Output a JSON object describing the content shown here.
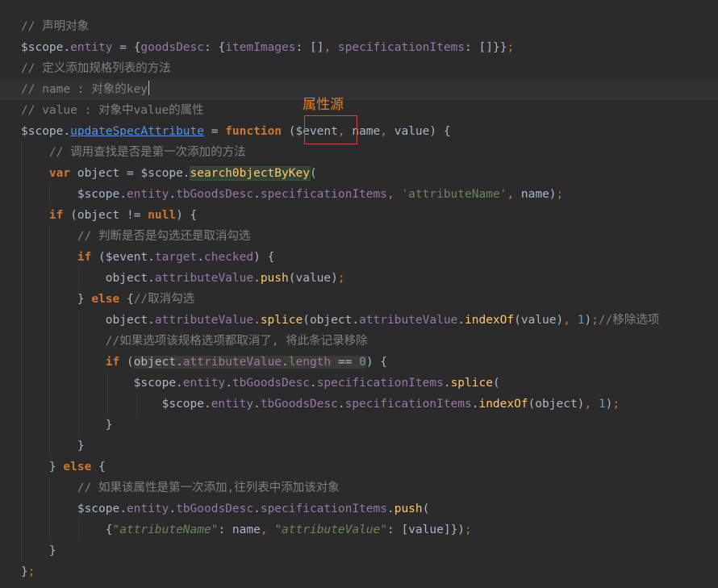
{
  "annotation": {
    "label": "属性源",
    "box_color": "#d8423a",
    "label_color": "#e87f1f"
  },
  "code": {
    "l1_comment": "// 声明对象",
    "l3_comment": "// 定义添加规格列表的方法",
    "l4_comment": "// name : 对象的key",
    "l5_comment": "// value : 对象中value的属性",
    "fn_name": "updateSpecAttribute",
    "call_search": "search0bjectByKey",
    "l7_comment": "// 调用查找是否是第一次添加的方法",
    "l11_comment": "// 判断是否是勾选还是取消勾选",
    "l14_comment": "//取消勾选",
    "l15_comment": "//移除选项",
    "l16_comment": "//如果选项该规格选项都取消了, 将此条记录移除",
    "l22_comment": "// 如果该属性是第一次添加,往列表中添加该对象",
    "str_attributeName_sq": "'attributeName'",
    "str_attributeName_dq": "\"attributeName\"",
    "str_attributeValue_dq": "\"attributeValue\""
  },
  "colors": {
    "background": "#2b2b2b",
    "keyword": "#cc7832",
    "property": "#9876aa",
    "function": "#ffc66d",
    "string": "#6a8759",
    "number": "#6897bb",
    "comment": "#808080",
    "text": "#a9b7c6"
  }
}
